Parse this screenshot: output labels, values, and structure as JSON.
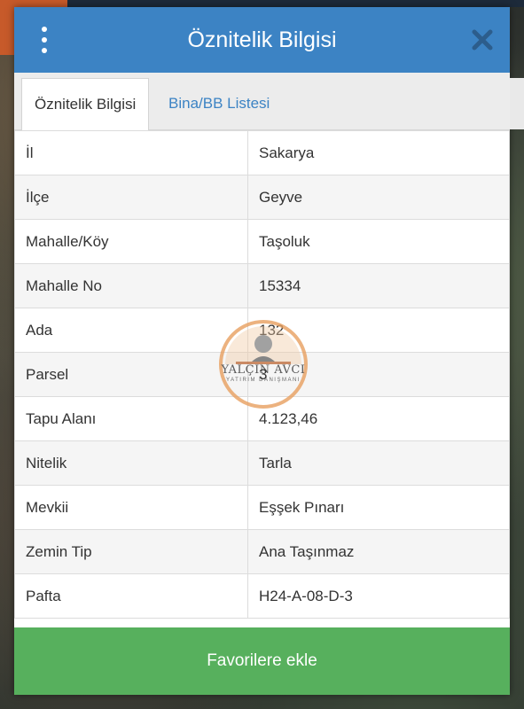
{
  "header": {
    "title": "Öznitelik Bilgisi",
    "menu_icon": "more-vert-icon",
    "close_icon": "close-icon"
  },
  "tabs": [
    {
      "label": "Öznitelik Bilgisi",
      "active": true
    },
    {
      "label": "Bina/BB Listesi",
      "active": false
    }
  ],
  "rows": [
    {
      "key": "İl",
      "value": "Sakarya"
    },
    {
      "key": "İlçe",
      "value": "Geyve"
    },
    {
      "key": "Mahalle/Köy",
      "value": "Taşoluk"
    },
    {
      "key": "Mahalle No",
      "value": "15334"
    },
    {
      "key": "Ada",
      "value": "132"
    },
    {
      "key": "Parsel",
      "value": "3"
    },
    {
      "key": "Tapu Alanı",
      "value": "4.123,46"
    },
    {
      "key": "Nitelik",
      "value": "Tarla"
    },
    {
      "key": "Mevkii",
      "value": "Eşşek Pınarı"
    },
    {
      "key": "Zemin Tip",
      "value": "Ana Taşınmaz"
    },
    {
      "key": "Pafta",
      "value": "H24-A-08-D-3"
    }
  ],
  "footer": {
    "button_label": "Favorilere ekle"
  },
  "watermark": {
    "line1": "YALÇIN AVCI",
    "line2": "YATIRIM DANIŞMANI"
  },
  "colors": {
    "header": "#3c83c4",
    "tab_link": "#3c83c4",
    "button": "#57b05d"
  }
}
